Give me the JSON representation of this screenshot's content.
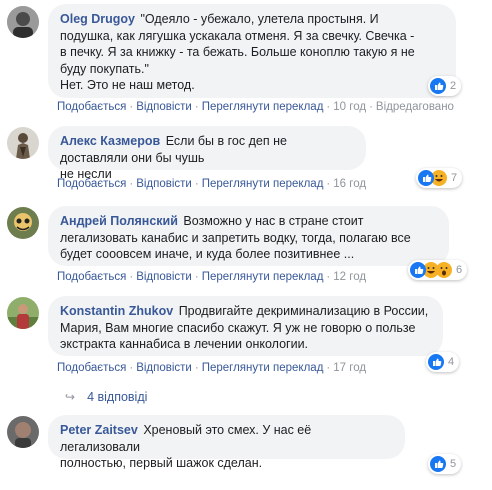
{
  "comments": [
    {
      "author": "Oleg Drugoy",
      "lines": [
        "\"Одеяло - убежало, улетела простыня. И",
        "подушка, как лягушка ускакала отменя. Я за свечку. Свечка -",
        "в печку. Я за книжку - та бежать. Больше коноплю такую я не",
        "буду покупать.\"",
        "Нет. Это не наш метод."
      ],
      "actions": [
        "Подобається",
        "Відповісти",
        "Переглянути переклад"
      ],
      "time": "10 год",
      "edited": "Відредаговано",
      "reaction_count": "2",
      "reactions": [
        "like-icon"
      ]
    },
    {
      "author": "Алекс Казмеров",
      "lines": [
        "Если бы в гос деп не доставляли они бы чушь",
        "не несли"
      ],
      "actions": [
        "Подобається",
        "Відповісти",
        "Переглянути переклад"
      ],
      "time": "16 год",
      "reaction_count": "7",
      "reactions": [
        "like-icon",
        "haha-icon"
      ]
    },
    {
      "author": "Андрей Полянский",
      "lines": [
        "Возможно у нас в стране стоит",
        "легализовать канабис и запретить водку, тогда, полагаю все",
        "будет сооовсем иначе, и куда более позитивнее ..."
      ],
      "actions": [
        "Подобається",
        "Відповісти",
        "Переглянути переклад"
      ],
      "time": "12 год",
      "reaction_count": "6",
      "reactions": [
        "like-icon",
        "haha-icon",
        "wow-icon"
      ]
    },
    {
      "author": "Konstantin Zhukov",
      "lines": [
        "Продвигайте декриминализацию в России,",
        "Мария, Вам многие спасибо скажут. Я уж не говорю о пользе",
        "экстракта каннабиса в лечении онкологии."
      ],
      "actions": [
        "Подобається",
        "Відповісти",
        "Переглянути переклад"
      ],
      "time": "17 год",
      "reaction_count": "4",
      "reactions": [
        "like-icon"
      ]
    },
    {
      "author": "Peter Zaitsev",
      "lines": [
        "Хреновый это смех. У нас её легализовали",
        "полностью, первый шажок сделан."
      ],
      "actions": [],
      "time": "",
      "reaction_count": "5",
      "reactions": [
        "like-icon"
      ]
    }
  ],
  "replies_link": "4 відповіді",
  "colors": {
    "link": "#385898",
    "bubble": "#f2f3f5",
    "like": "#1877f2",
    "haha": "#f7b125",
    "meta": "#90949c"
  }
}
